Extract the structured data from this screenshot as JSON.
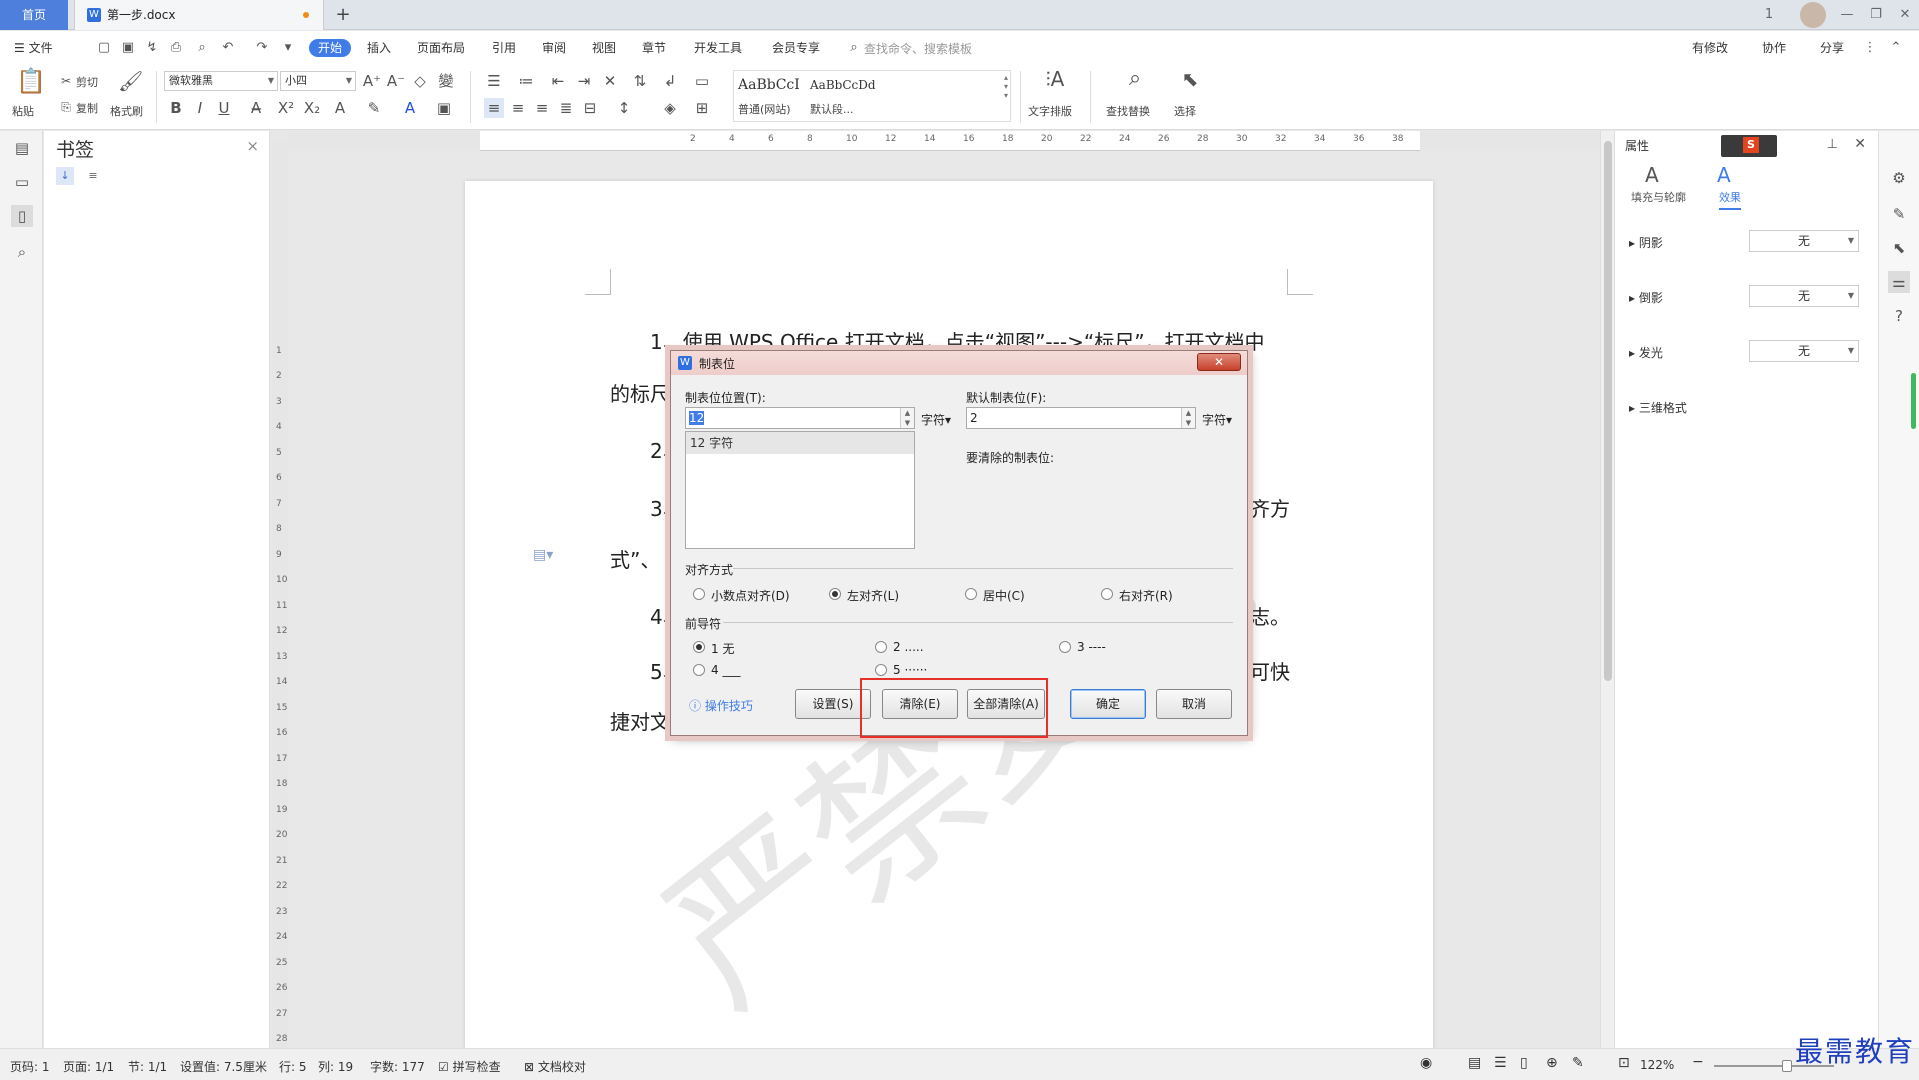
{
  "titlebar": {
    "home_tab": "首页",
    "doc_tab": "第一步.docx",
    "new_tab": "+",
    "window_buttons": [
      "1",
      "—",
      "❐",
      "✕"
    ]
  },
  "menu": {
    "file": "☰ 文件",
    "tabs": [
      "开始",
      "插入",
      "页面布局",
      "引用",
      "审阅",
      "视图",
      "章节",
      "开发工具",
      "会员专享"
    ],
    "search": "查找命令、搜索模板",
    "right": [
      "有修改",
      "协作",
      "分享"
    ]
  },
  "toolbar": {
    "paste": "粘贴",
    "cut": "剪切",
    "copy": "复制",
    "format_painter": "格式刷",
    "font_name": "微软雅黑",
    "font_size": "小四",
    "style_normal_preview": "AaBbCcI",
    "style_normal": "普通(网站)",
    "style_default_preview": "AaBbCcDd",
    "style_default": "默认段...",
    "text_layout": "文字排版",
    "find_replace": "查找替换",
    "select": "选择"
  },
  "bookmark_pane": {
    "title": "书签",
    "close": "×"
  },
  "document": {
    "lines": [
      "1、使用 WPS Office 打开文档，点击“视图”--->“标尺”，打开文档中",
      "的标尺",
      "2、",
      "3、",
      "齐方",
      "式”、",
      "4、",
      "志。",
      "5、",
      "可快",
      "捷对文"
    ],
    "watermark": "严禁复制"
  },
  "dialog": {
    "title": "制表位",
    "close": "✕",
    "tab_position_label": "制表位位置(T):",
    "tab_position_value": "12",
    "unit": "字符",
    "default_tab_label": "默认制表位(F):",
    "default_tab_value": "2",
    "list_items": [
      "12 字符"
    ],
    "to_clear_label": "要清除的制表位:",
    "alignment_label": "对齐方式",
    "alignment_options": [
      "小数点对齐(D)",
      "左对齐(L)",
      "居中(C)",
      "右对齐(R)"
    ],
    "alignment_selected": "左对齐(L)",
    "leader_label": "前导符",
    "leader_options": [
      "1 无",
      "2 .....",
      "3 ----",
      "4 ___",
      "5 ······"
    ],
    "leader_selected": "1 无",
    "tips": "操作技巧",
    "btn_set": "设置(S)",
    "btn_clear": "清除(E)",
    "btn_clear_all": "全部清除(A)",
    "btn_ok": "确定",
    "btn_cancel": "取消"
  },
  "right_pane": {
    "title": "属性",
    "tab_fill": "填充与轮廓",
    "tab_effect": "效果",
    "rows": [
      {
        "label": "阴影",
        "value": "无"
      },
      {
        "label": "倒影",
        "value": "无"
      },
      {
        "label": "发光",
        "value": "无"
      },
      {
        "label": "三维格式",
        "value": ""
      }
    ]
  },
  "statusbar": {
    "page_num": "页码: 1",
    "pages": "页面: 1/1",
    "section": "节: 1/1",
    "setting": "设置值: 7.5厘米",
    "row": "行: 5",
    "col": "列: 19",
    "words": "字数: 177",
    "spell": "拼写检查",
    "proof": "文档校对",
    "zoom": "122%"
  },
  "brand": "最需教育",
  "colors": {
    "accent": "#3f7ce8",
    "highlight": "#e8302a",
    "brand": "#1f3fbf"
  }
}
